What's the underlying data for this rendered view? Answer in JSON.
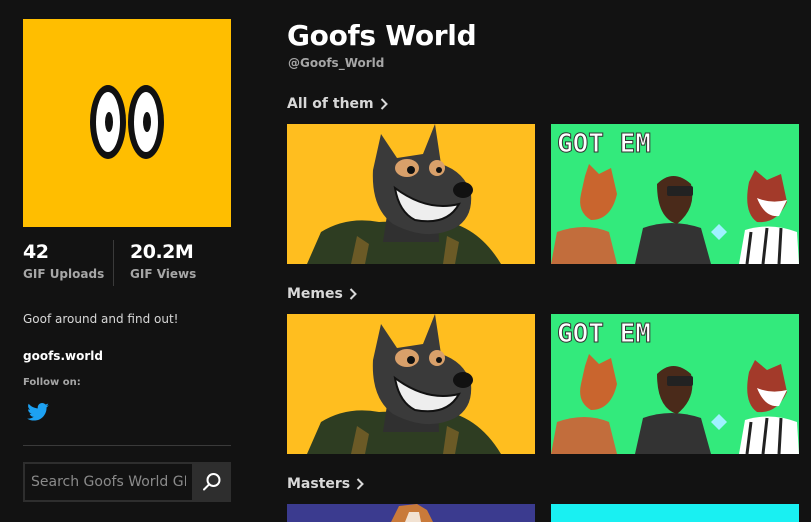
{
  "profile": {
    "name": "Goofs World",
    "handle": "@Goofs_World",
    "bio": "Goof around and find out!",
    "website": "goofs.world",
    "follow_label": "Follow on:",
    "social": [
      "twitter-icon"
    ],
    "brand_color": "#ffbe00"
  },
  "stats": [
    {
      "value": "42",
      "label": "GIF Uploads"
    },
    {
      "value": "20.2M",
      "label": "GIF Views"
    }
  ],
  "search": {
    "placeholder": "Search Goofs World GIFs"
  },
  "sections": [
    {
      "title": "All of them",
      "gifs": [
        {
          "caption": ""
        },
        {
          "caption": "GOT EM"
        }
      ]
    },
    {
      "title": "Memes",
      "gifs": [
        {
          "caption": ""
        },
        {
          "caption": "GOT EM"
        }
      ]
    },
    {
      "title": "Masters",
      "gifs": [
        {
          "caption": ""
        },
        {
          "caption": ""
        }
      ]
    }
  ]
}
